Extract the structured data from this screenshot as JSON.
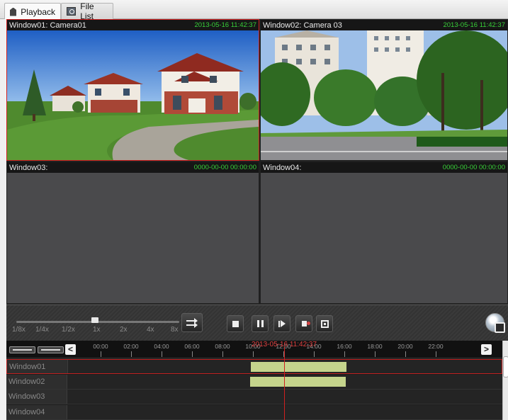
{
  "tabs": [
    {
      "label": "Playback",
      "icon": "playback-icon",
      "active": true
    },
    {
      "label": "File List",
      "icon": "file-list-icon",
      "active": false
    }
  ],
  "windows": [
    {
      "title": "Window01: Camera01",
      "time": "2013-05-16 11:42:37",
      "selected": true,
      "content": "house-scene"
    },
    {
      "title": "Window02: Camera 03",
      "time": "2013-05-16 11:42:37",
      "selected": false,
      "content": "street-scene"
    },
    {
      "title": "Window03:",
      "time": "0000-00-00 00:00:00",
      "selected": false,
      "content": "empty"
    },
    {
      "title": "Window04:",
      "time": "0000-00-00 00:00:00",
      "selected": false,
      "content": "empty"
    }
  ],
  "controls": {
    "speed_labels": [
      "1/8x",
      "1/4x",
      "1/2x",
      "1x",
      "2x",
      "4x",
      "8x"
    ],
    "current_speed": "1x",
    "buttons": [
      "cycle-icon",
      "stop-icon",
      "pause-icon",
      "single-frame-icon",
      "sound-icon",
      "capture-icon",
      "download-icon"
    ]
  },
  "timeline": {
    "current_time": "2013-05-16 11:42:37",
    "hours": [
      "00:00",
      "02:00",
      "04:00",
      "06:00",
      "08:00",
      "10:00",
      "12:00",
      "14:00",
      "16:00",
      "18:00",
      "20:00",
      "22:00"
    ],
    "prev_label": "<",
    "next_label": ">",
    "tracks": [
      {
        "label": "Window01",
        "selected": true,
        "segments": [
          {
            "start_hour": 9.8,
            "end_hour": 16.1
          }
        ]
      },
      {
        "label": "Window02",
        "selected": false,
        "segments": [
          {
            "start_hour": 9.8,
            "end_hour": 16.1
          }
        ]
      },
      {
        "label": "Window03",
        "selected": false,
        "segments": []
      },
      {
        "label": "Window04",
        "selected": false,
        "segments": []
      }
    ]
  },
  "colors": {
    "accent_red": "#d02020",
    "time_green": "#38d038",
    "segment": "#c5d48c"
  }
}
